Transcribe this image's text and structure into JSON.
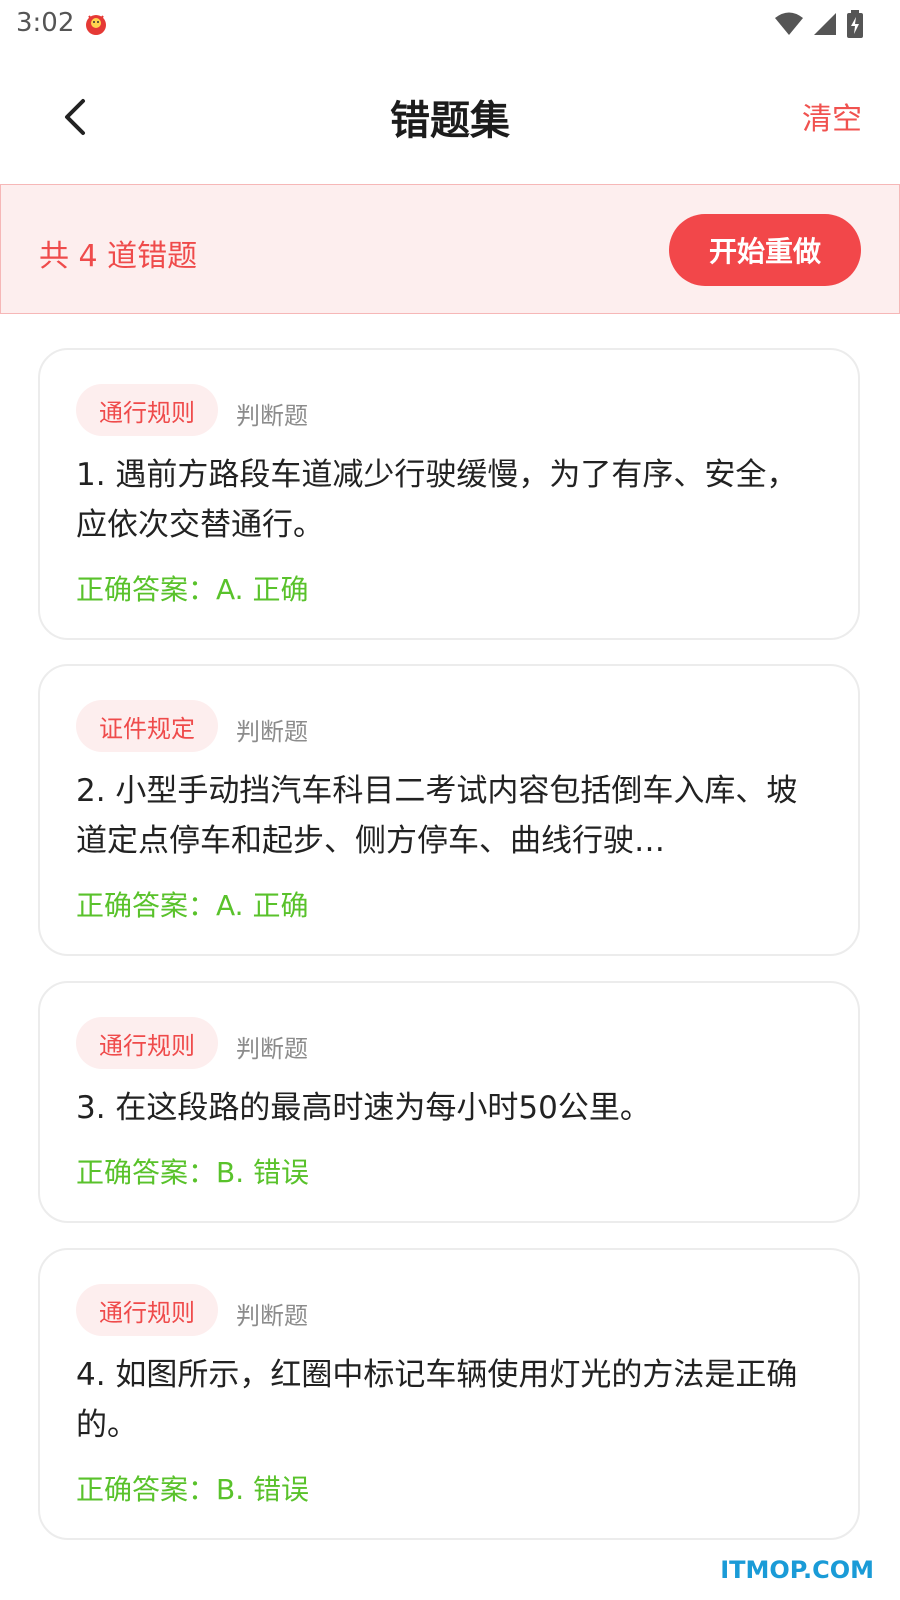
{
  "status_bar": {
    "time": "3:02"
  },
  "header": {
    "title": "错题集",
    "clear_label": "清空"
  },
  "summary": {
    "text": "共 4 道错题",
    "redo_label": "开始重做"
  },
  "questions": [
    {
      "tag": "通行规则",
      "type": "判断题",
      "text": "1. 遇前方路段车道减少行驶缓慢，为了有序、安全，应依次交替通行。",
      "answer": "正确答案：A. 正确"
    },
    {
      "tag": "证件规定",
      "type": "判断题",
      "text": "2. 小型手动挡汽车科目二考试内容包括倒车入库、坡道定点停车和起步、侧方停车、曲线行驶…",
      "answer": "正确答案：A. 正确"
    },
    {
      "tag": "通行规则",
      "type": "判断题",
      "text": "3. 在这段路的最高时速为每小时50公里。",
      "answer": "正确答案：B. 错误"
    },
    {
      "tag": "通行规则",
      "type": "判断题",
      "text": "4. 如图所示，红圈中标记车辆使用灯光的方法是正确的。",
      "answer": "正确答案：B. 错误"
    }
  ],
  "watermark": "ITMOP.COM"
}
